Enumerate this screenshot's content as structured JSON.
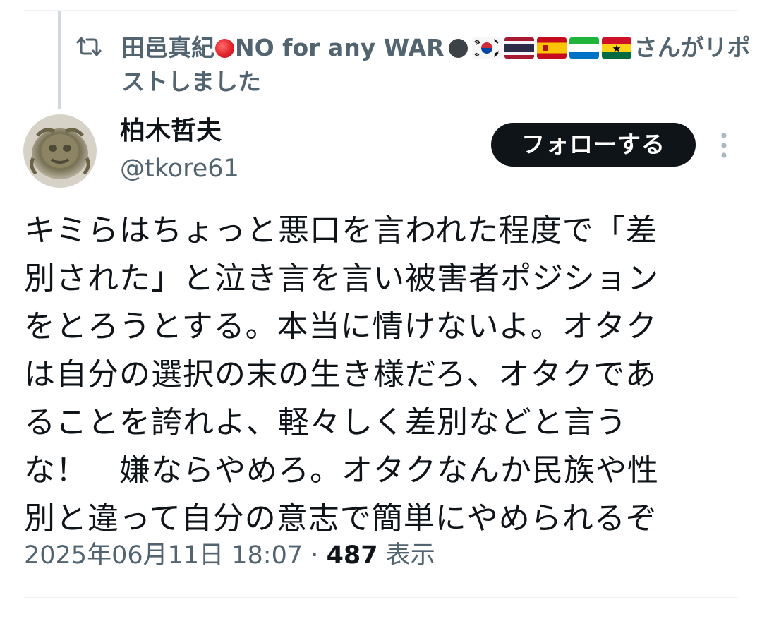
{
  "repost": {
    "reposter_name": "田邑真紀",
    "reposter_suffix": "NO for any WAR",
    "reposted_text": "さんがリポストしました"
  },
  "author": {
    "display_name": "柏木哲夫",
    "handle": "@tkore61"
  },
  "follow_button": {
    "label": "フォローする"
  },
  "tweet": {
    "lines": [
      "キミらはちょっと悪口を言われた程度で「差",
      "別された」と泣き言を言い被害者ポジション",
      "をとろうとする。本当に情けないよ。オタク",
      "は自分の選択の末の生き様だろ、オタクであ",
      "ることを誇れよ、軽々しく差別などと言う",
      "な！　嫌ならやめろ。オタクなんか民族や性",
      "別と違って自分の意志で簡単にやめられるぞ"
    ]
  },
  "meta": {
    "timestamp": "2025年06月11日 18:07",
    "separator": "·",
    "views_count": "487",
    "views_label": "表示"
  },
  "icons": {
    "repost": "repost-icon",
    "more": "more-vertical-icon",
    "flags": [
      "flag-south-korea",
      "flag-thailand",
      "flag-spain",
      "flag-sierra-leone",
      "flag-ghana"
    ]
  },
  "colors": {
    "text_primary": "#0f1419",
    "text_secondary": "#536471",
    "follow_button_bg": "#0f1419",
    "follow_button_text": "#ffffff",
    "thread_line": "#cfd9de",
    "divider": "#eff3f4"
  }
}
